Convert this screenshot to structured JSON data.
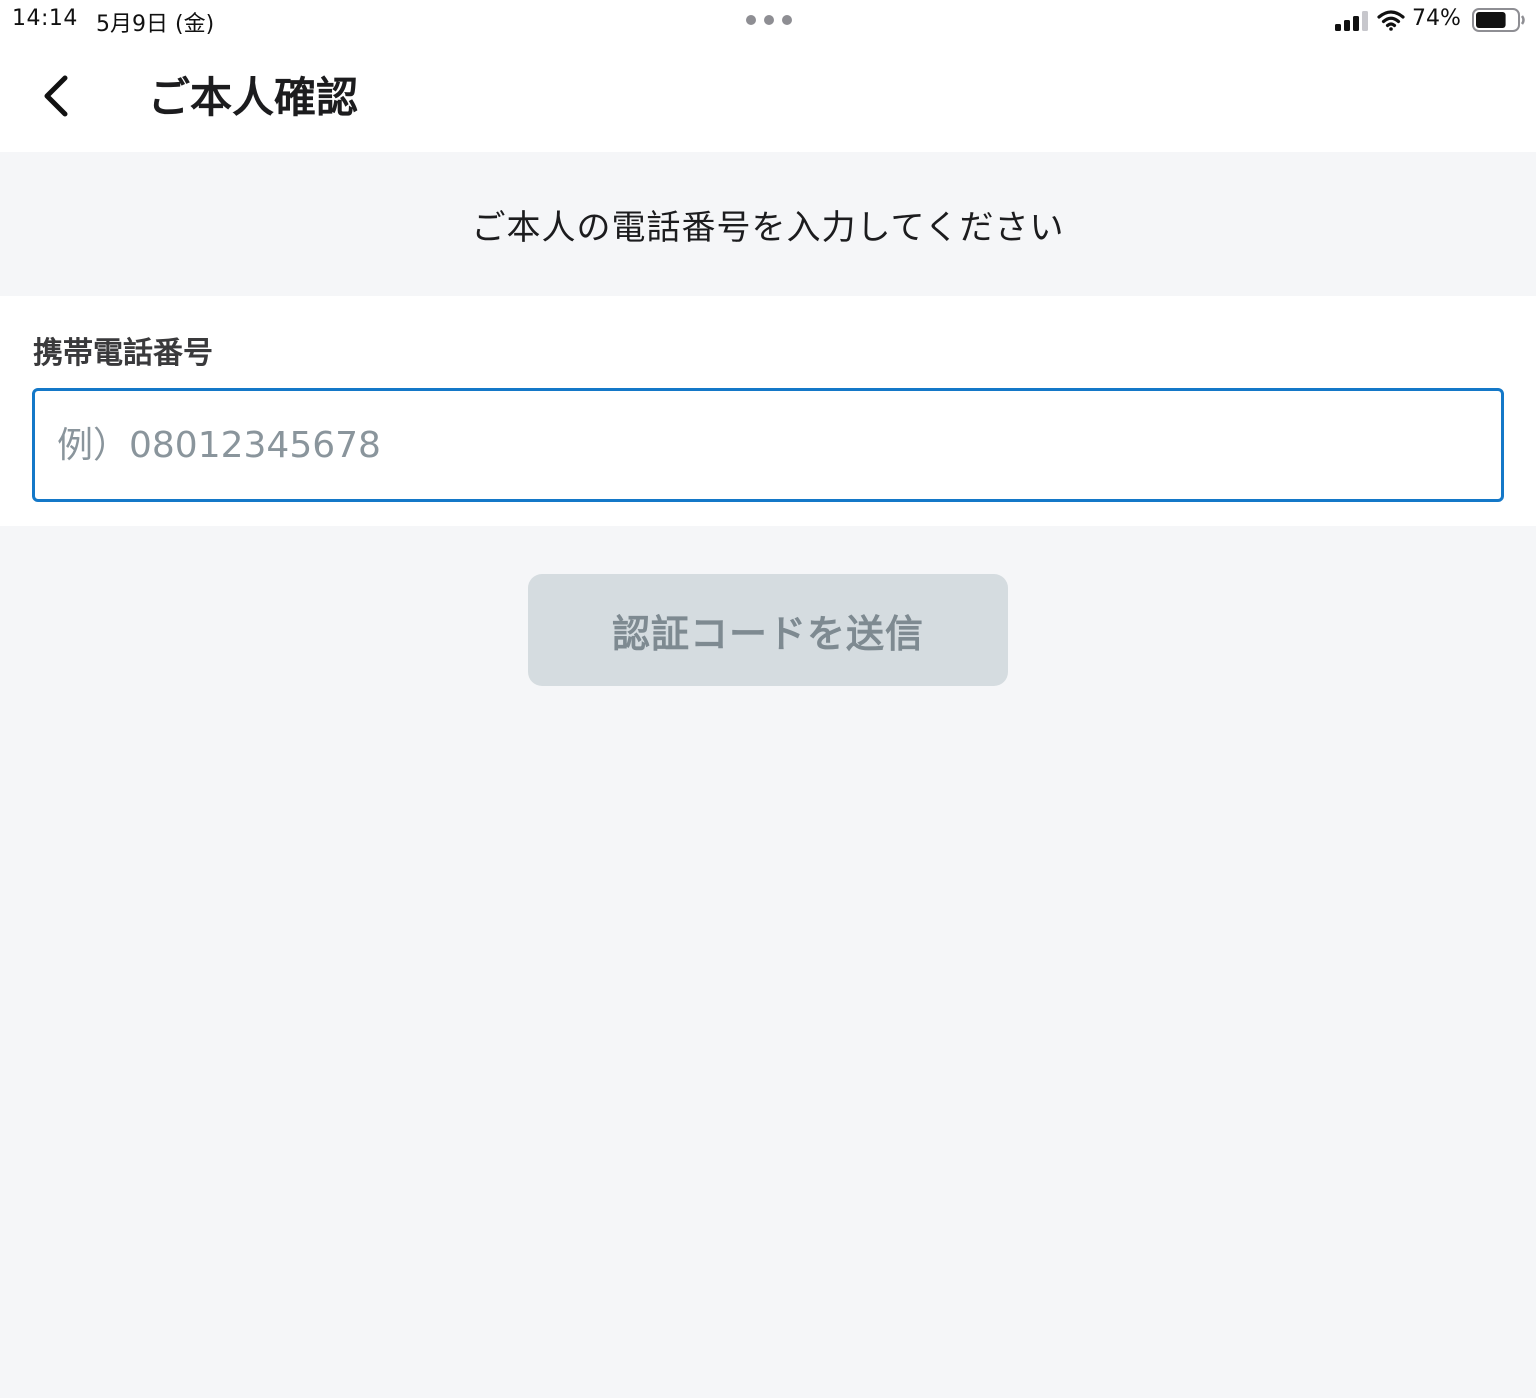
{
  "status_bar": {
    "time": "14:14",
    "date": "5月9日 (金)",
    "battery_percent": "74%",
    "battery_level": 0.74,
    "icons": [
      "cellular-signal-icon",
      "wifi-icon",
      "battery-icon",
      "multitask-dots-icon"
    ]
  },
  "header": {
    "back_icon": "chevron-left-icon",
    "title": "ご本人確認"
  },
  "instruction": {
    "text": "ご本人の電話番号を入力してください"
  },
  "form": {
    "phone_label": "携帯電話番号",
    "phone_value": "",
    "phone_placeholder": "例）08012345678"
  },
  "actions": {
    "send_code_label": "認証コードを送信",
    "send_code_enabled": false
  },
  "colors": {
    "accent": "#1478c8",
    "background": "#f5f6f8",
    "surface": "#ffffff",
    "button_disabled_bg": "#d5dce0",
    "button_disabled_text": "#7e8a91",
    "placeholder": "#8a959c"
  }
}
